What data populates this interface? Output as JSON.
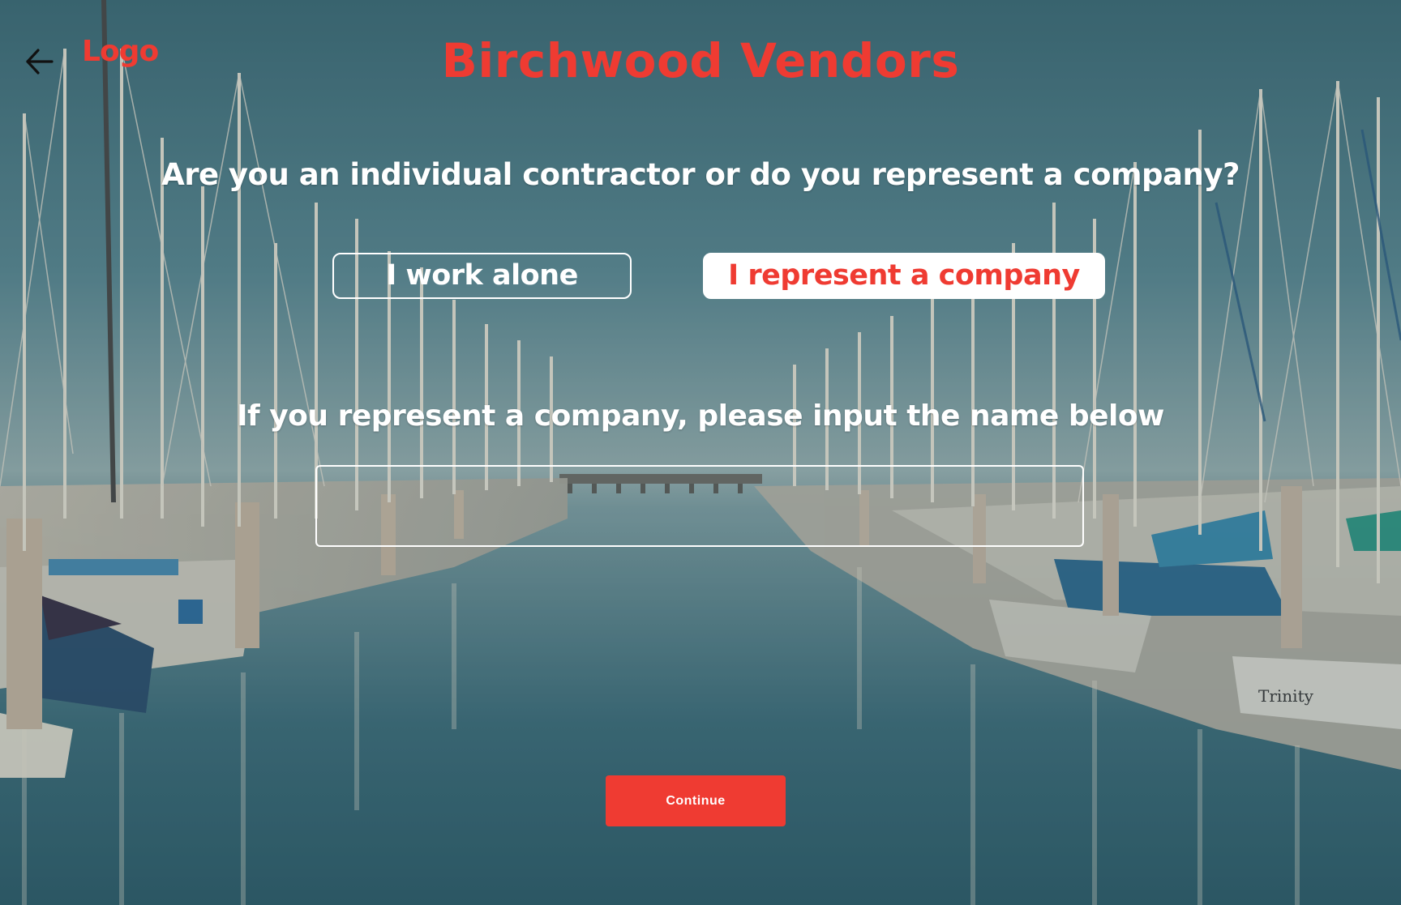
{
  "app": {
    "logo_text": "Logo",
    "brand_title": "Birchwood Vendors"
  },
  "colors": {
    "brand_red": "#ef3b32",
    "white": "#ffffff",
    "water_tint": "#4f7f8c"
  },
  "nav": {
    "back_icon": "arrow-left-icon"
  },
  "form": {
    "question": "Are you an individual contractor or do you represent a company?",
    "options": [
      {
        "label": "I work alone",
        "selected": false
      },
      {
        "label": "I represent a company",
        "selected": true
      }
    ],
    "company_prompt": "If you represent a company, please input the name below",
    "company_name_value": "",
    "company_name_placeholder": "",
    "continue_label": "Continue"
  },
  "background": {
    "boat_name": "Trinity"
  }
}
